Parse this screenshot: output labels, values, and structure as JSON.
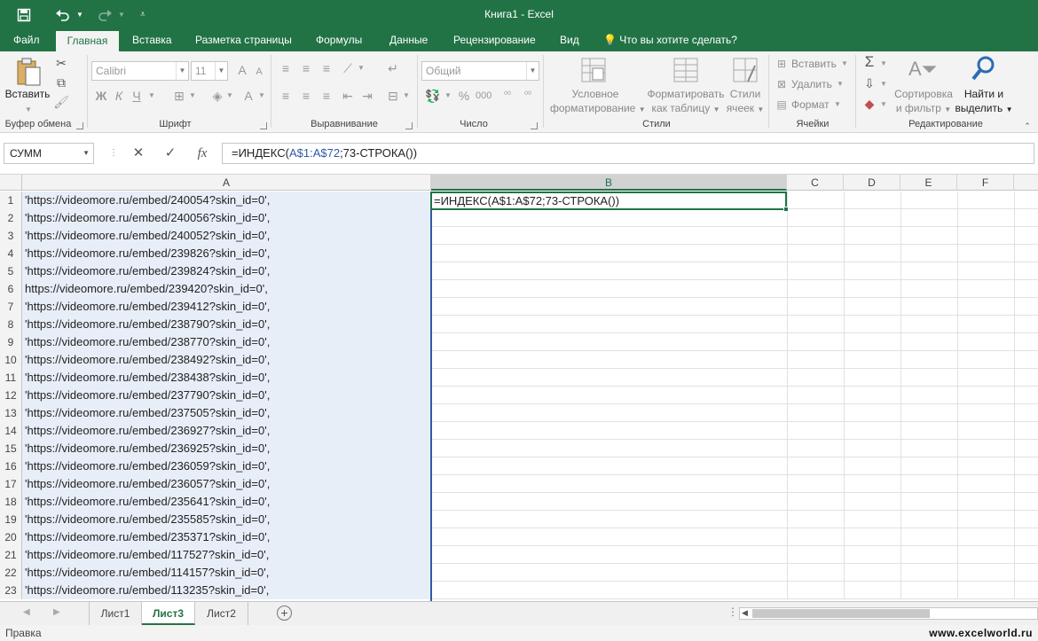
{
  "window": {
    "title": "Книга1 - Excel"
  },
  "quick_access": {
    "save_icon": "save-icon",
    "undo_icon": "undo-icon",
    "redo_icon": "redo-icon",
    "customize_icon": "customize-icon"
  },
  "tabs": [
    {
      "label": "Файл"
    },
    {
      "label": "Главная"
    },
    {
      "label": "Вставка"
    },
    {
      "label": "Разметка страницы"
    },
    {
      "label": "Формулы"
    },
    {
      "label": "Данные"
    },
    {
      "label": "Рецензирование"
    },
    {
      "label": "Вид"
    }
  ],
  "tell_me": "Что вы хотите сделать?",
  "ribbon": {
    "clipboard": {
      "paste": "Вставить",
      "label": "Буфер обмена"
    },
    "font": {
      "name": "Calibri",
      "size": "11",
      "bold": "Ж",
      "italic": "К",
      "underline": "Ч",
      "label": "Шрифт"
    },
    "alignment": {
      "label": "Выравнивание"
    },
    "number": {
      "format": "Общий",
      "label": "Число"
    },
    "styles": {
      "conditional_1": "Условное",
      "conditional_2": "форматирование",
      "table_1": "Форматировать",
      "table_2": "как таблицу",
      "cell_1": "Стили",
      "cell_2": "ячеек",
      "label": "Стили"
    },
    "cells": {
      "insert": "Вставить",
      "delete": "Удалить",
      "format": "Формат",
      "label": "Ячейки"
    },
    "editing": {
      "sort_1": "Сортировка",
      "sort_2": "и фильтр",
      "find_1": "Найти и",
      "find_2": "выделить",
      "label": "Редактирование"
    }
  },
  "formula_bar": {
    "name_box": "СУММ",
    "cancel": "✕",
    "enter": "✓",
    "fx": "fx",
    "formula_prefix": "=ИНДЕКС(",
    "formula_ref": "A$1:A$72",
    "formula_suffix": ";73-СТРОКА())"
  },
  "columns": [
    "A",
    "B",
    "C",
    "D",
    "E",
    "F"
  ],
  "active_cell_text": "=ИНДЕКС(A$1:A$72;73-СТРОКА())",
  "rows": [
    {
      "n": "1",
      "a": "'https://videomore.ru/embed/240054?skin_id=0',"
    },
    {
      "n": "2",
      "a": "'https://videomore.ru/embed/240056?skin_id=0',"
    },
    {
      "n": "3",
      "a": "'https://videomore.ru/embed/240052?skin_id=0',"
    },
    {
      "n": "4",
      "a": "'https://videomore.ru/embed/239826?skin_id=0',"
    },
    {
      "n": "5",
      "a": "'https://videomore.ru/embed/239824?skin_id=0',"
    },
    {
      "n": "6",
      "a": "https://videomore.ru/embed/239420?skin_id=0',"
    },
    {
      "n": "7",
      "a": "'https://videomore.ru/embed/239412?skin_id=0',"
    },
    {
      "n": "8",
      "a": "'https://videomore.ru/embed/238790?skin_id=0',"
    },
    {
      "n": "9",
      "a": "'https://videomore.ru/embed/238770?skin_id=0',"
    },
    {
      "n": "10",
      "a": "'https://videomore.ru/embed/238492?skin_id=0',"
    },
    {
      "n": "11",
      "a": "'https://videomore.ru/embed/238438?skin_id=0',"
    },
    {
      "n": "12",
      "a": "'https://videomore.ru/embed/237790?skin_id=0',"
    },
    {
      "n": "13",
      "a": "'https://videomore.ru/embed/237505?skin_id=0',"
    },
    {
      "n": "14",
      "a": "'https://videomore.ru/embed/236927?skin_id=0',"
    },
    {
      "n": "15",
      "a": "'https://videomore.ru/embed/236925?skin_id=0',"
    },
    {
      "n": "16",
      "a": "'https://videomore.ru/embed/236059?skin_id=0',"
    },
    {
      "n": "17",
      "a": "'https://videomore.ru/embed/236057?skin_id=0',"
    },
    {
      "n": "18",
      "a": "'https://videomore.ru/embed/235641?skin_id=0',"
    },
    {
      "n": "19",
      "a": "'https://videomore.ru/embed/235585?skin_id=0',"
    },
    {
      "n": "20",
      "a": "'https://videomore.ru/embed/235371?skin_id=0',"
    },
    {
      "n": "21",
      "a": "'https://videomore.ru/embed/117527?skin_id=0',"
    },
    {
      "n": "22",
      "a": "'https://videomore.ru/embed/114157?skin_id=0',"
    },
    {
      "n": "23",
      "a": "'https://videomore.ru/embed/113235?skin_id=0',"
    }
  ],
  "sheets": [
    {
      "label": "Лист1"
    },
    {
      "label": "Лист3"
    },
    {
      "label": "Лист2"
    }
  ],
  "status": {
    "mode": "Правка",
    "watermark": "www.excelworld.ru"
  },
  "colors": {
    "accent": "#217346",
    "column_a_fill": "#e8eef8",
    "ref_blue": "#2d5ba8"
  }
}
